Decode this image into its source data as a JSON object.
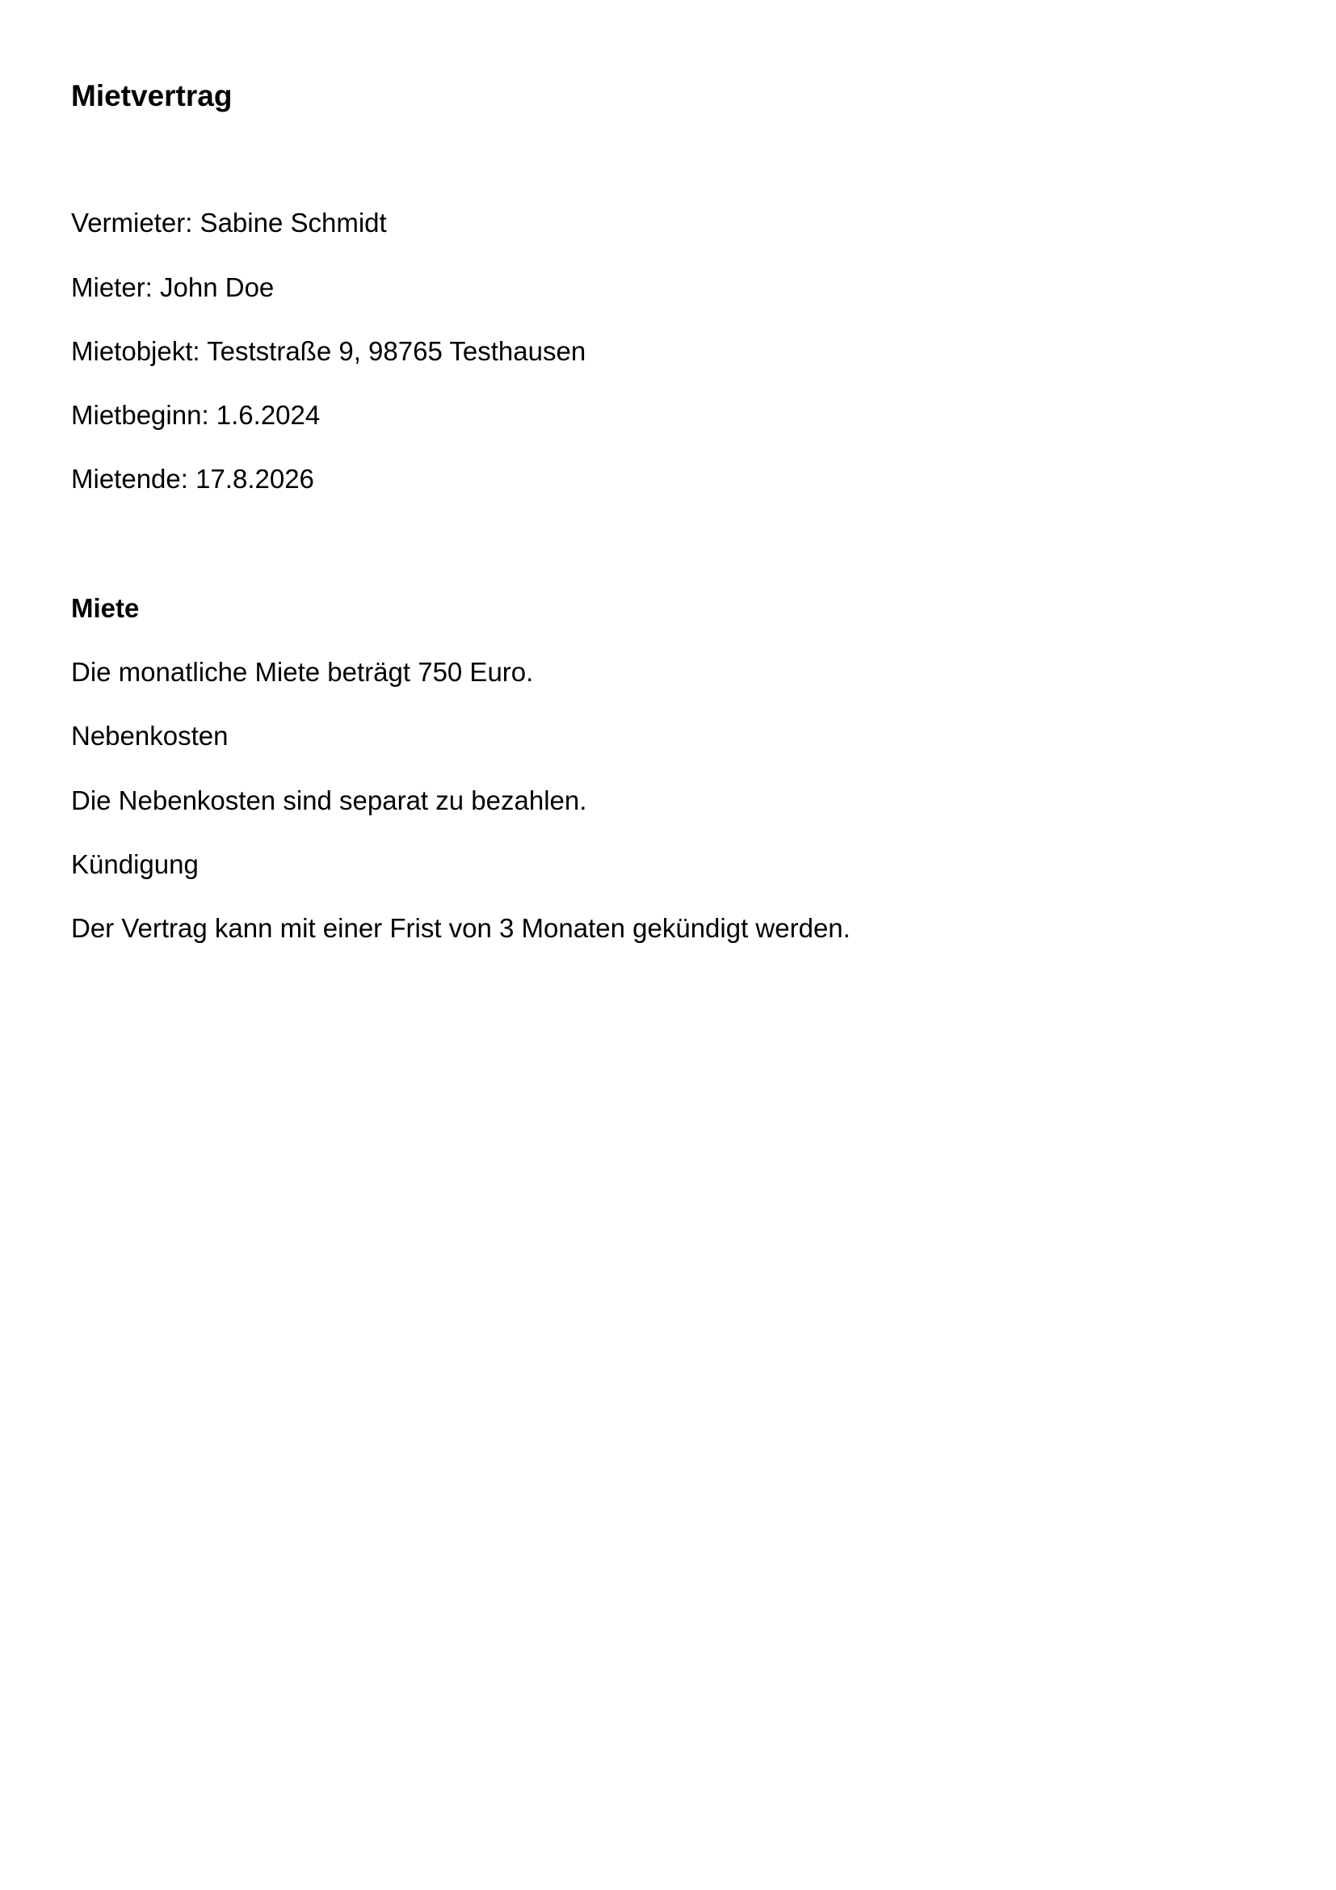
{
  "document": {
    "title": "Mietvertrag",
    "parties": {
      "landlord": "Vermieter: Sabine Schmidt",
      "tenant": "Mieter: John Doe",
      "property": "Mietobjekt: Teststraße 9, 98765 Testhausen",
      "start": "Mietbeginn: 1.6.2024",
      "end": "Mietende: 17.8.2026"
    },
    "rent": {
      "heading": "Miete",
      "amount_text": "Die monatliche Miete beträgt 750 Euro."
    },
    "additional_costs": {
      "heading": "Nebenkosten",
      "text": "Die Nebenkosten sind separat zu bezahlen."
    },
    "termination": {
      "heading": "Kündigung",
      "text": "Der Vertrag kann mit einer Frist von 3 Monaten gekündigt werden."
    }
  }
}
